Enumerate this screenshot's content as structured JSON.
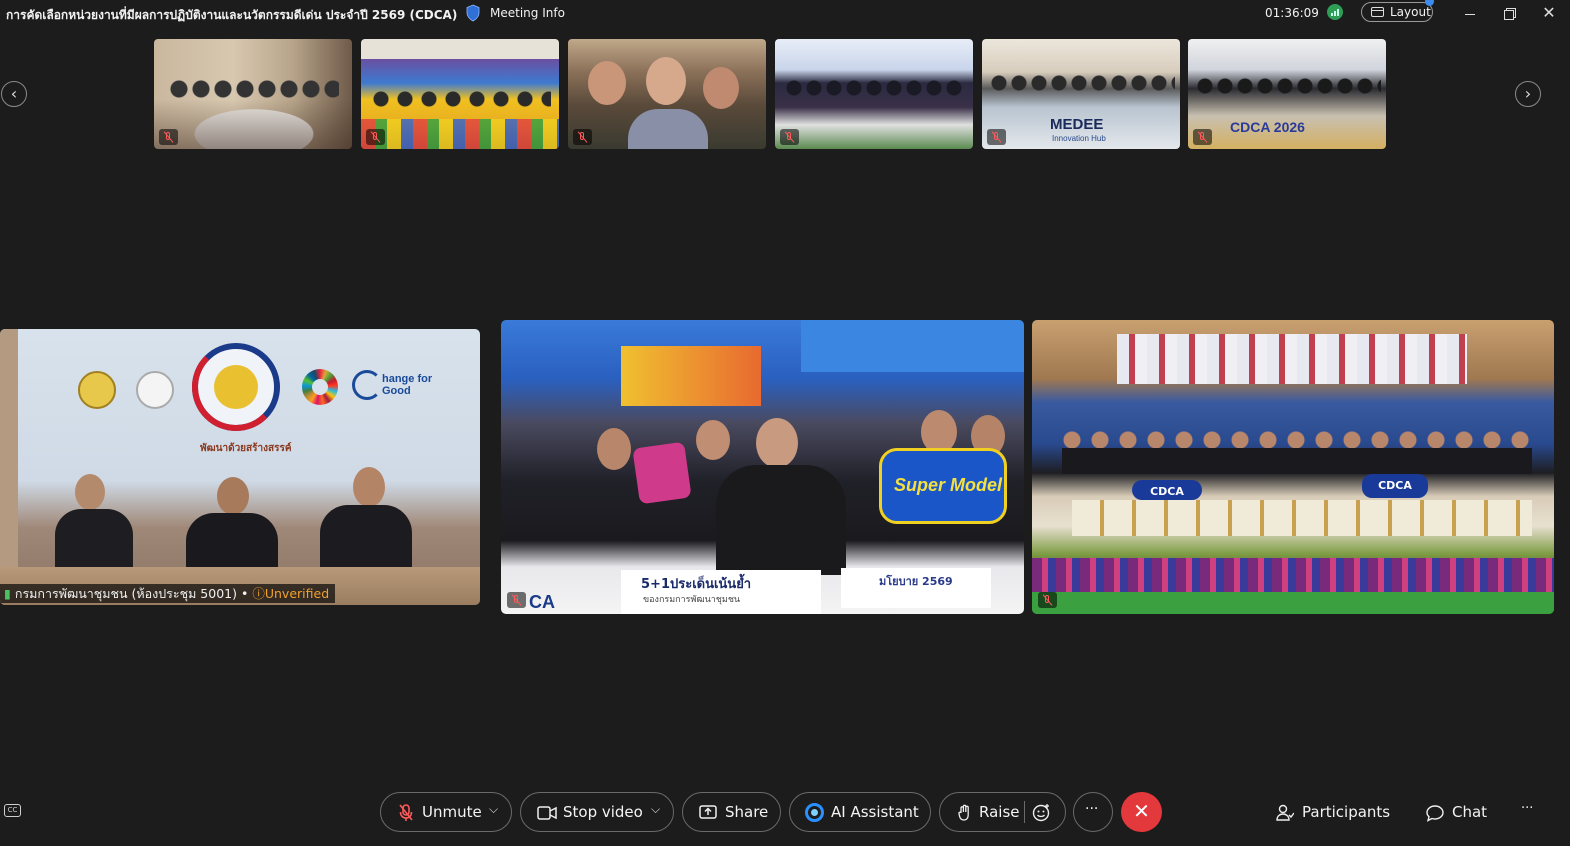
{
  "window": {
    "title": "การคัดเลือกหน่วยงานที่มีผลการปฏิบัติงานและนวัตกรรมดีเด่น ประจำปี 2569 (CDCA)",
    "meeting_info_label": "Meeting Info",
    "elapsed_time": "01:36:09",
    "layout_label": "Layout"
  },
  "filmstrip": {
    "thumbnails": [
      {
        "id": "thumb-1",
        "muted": true
      },
      {
        "id": "thumb-2",
        "muted": true
      },
      {
        "id": "thumb-3",
        "muted": true
      },
      {
        "id": "thumb-4",
        "muted": true
      },
      {
        "id": "thumb-5",
        "muted": true,
        "caption": "MEDEE",
        "subcaption": "Innovation Hub"
      },
      {
        "id": "thumb-6",
        "muted": true,
        "caption": "CDCA 2026"
      }
    ]
  },
  "main_tiles": [
    {
      "id": "tile-1",
      "participant_name": "กรมการพัฒนาชุมชน (ห้องประชุม 5001)",
      "separator": "•",
      "status": "Unverified",
      "backdrop_text": "hange for Good",
      "backdrop_caption": "พัฒนาด้วยสร้างสรรค์"
    },
    {
      "id": "tile-2",
      "muted": true,
      "sign_super_model": "Super Model",
      "banner_text": "5+1ประเด็นเน้นย้ำ",
      "banner_sub": "ของกรมการพัฒนาชุมชน",
      "date_text": "มโยบาย 2569",
      "logo_text": "CA"
    },
    {
      "id": "tile-3",
      "muted": true,
      "sign_left": "CDCA",
      "sign_right": "CDCA"
    }
  ],
  "toolbar": {
    "unmute_label": "Unmute",
    "stop_video_label": "Stop video",
    "share_label": "Share",
    "ai_assistant_label": "AI Assistant",
    "raise_label": "Raise",
    "more_label": "···",
    "participants_label": "Participants",
    "chat_label": "Chat",
    "overflow_label": "···",
    "cc_label": "CC"
  },
  "colors": {
    "background": "#1c1c1c",
    "leave": "#e3393c",
    "muted_mic": "#ff5a5a",
    "unverified": "#f0a030",
    "accent": "#3c8cf0",
    "ai_icon": "#2a8fff"
  }
}
